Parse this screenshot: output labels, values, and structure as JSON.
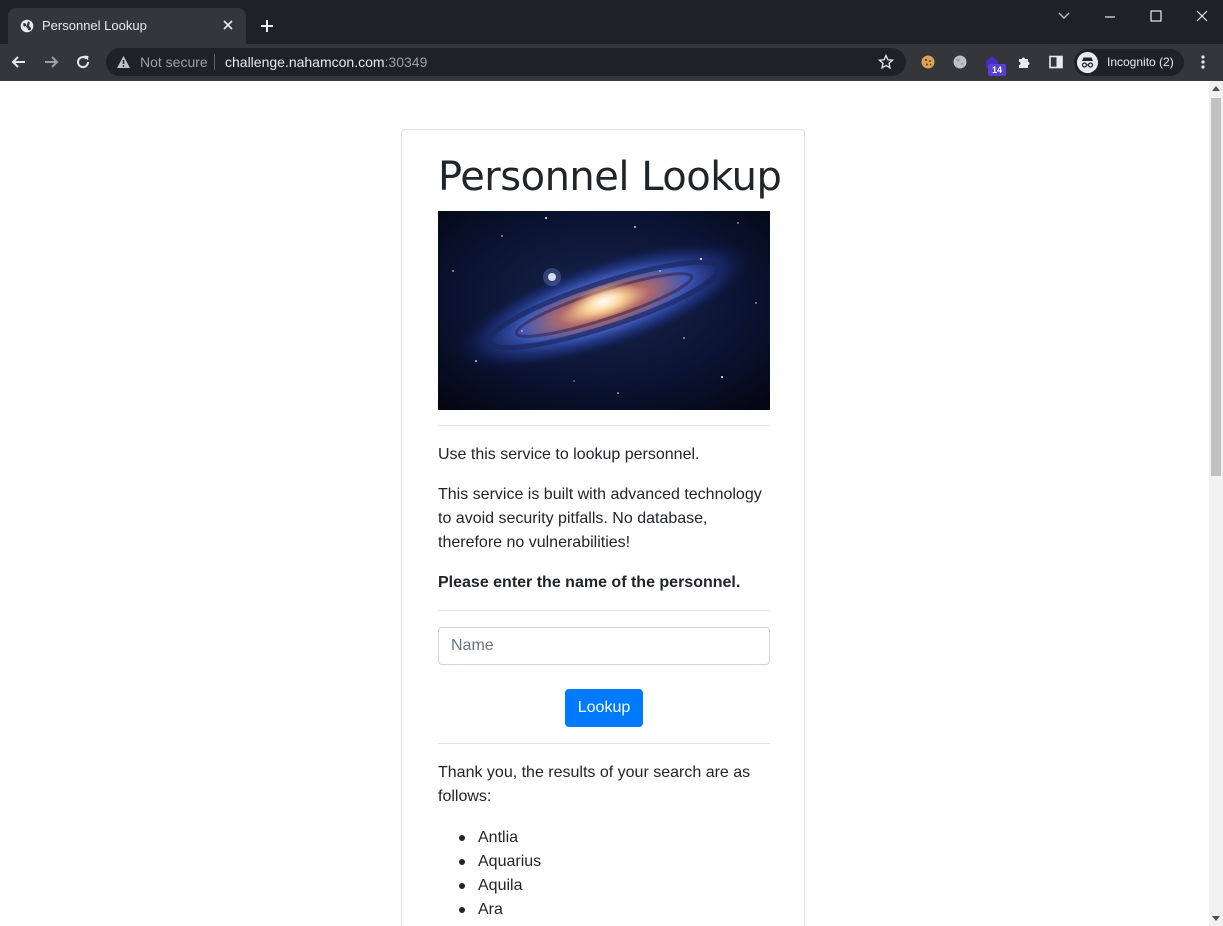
{
  "browser": {
    "tab_title": "Personnel Lookup",
    "security_label": "Not secure",
    "url_host": "challenge.nahamcon.com",
    "url_port": ":30349",
    "extension_badge": "14",
    "profile_label": "Incognito (2)"
  },
  "page": {
    "heading": "Personnel Lookup",
    "intro": "Use this service to lookup personnel.",
    "description": "This service is built with advanced technology to avoid security pitfalls. No database, therefore no vulnerabilities!",
    "prompt": "Please enter the name of the personnel.",
    "search": {
      "placeholder": "Name",
      "value": ""
    },
    "submit_label": "Lookup",
    "results_intro": "Thank you, the results of your search are as follows:",
    "results": [
      "Antlia",
      "Aquarius",
      "Aquila",
      "Ara"
    ]
  },
  "colors": {
    "chrome_dark": "#202124",
    "chrome_toolbar": "#35363a",
    "primary_button": "#007bff",
    "body_text": "#212529"
  },
  "icons": [
    "globe-icon",
    "close-icon",
    "plus-icon",
    "chevron-down-icon",
    "minimize-icon",
    "maximize-icon",
    "back-arrow-icon",
    "forward-arrow-icon",
    "reload-icon",
    "warning-icon",
    "star-icon",
    "cookie-icon",
    "moon-icon",
    "extension-icon",
    "puzzle-icon",
    "side-panel-icon",
    "incognito-icon",
    "kebab-menu-icon"
  ]
}
